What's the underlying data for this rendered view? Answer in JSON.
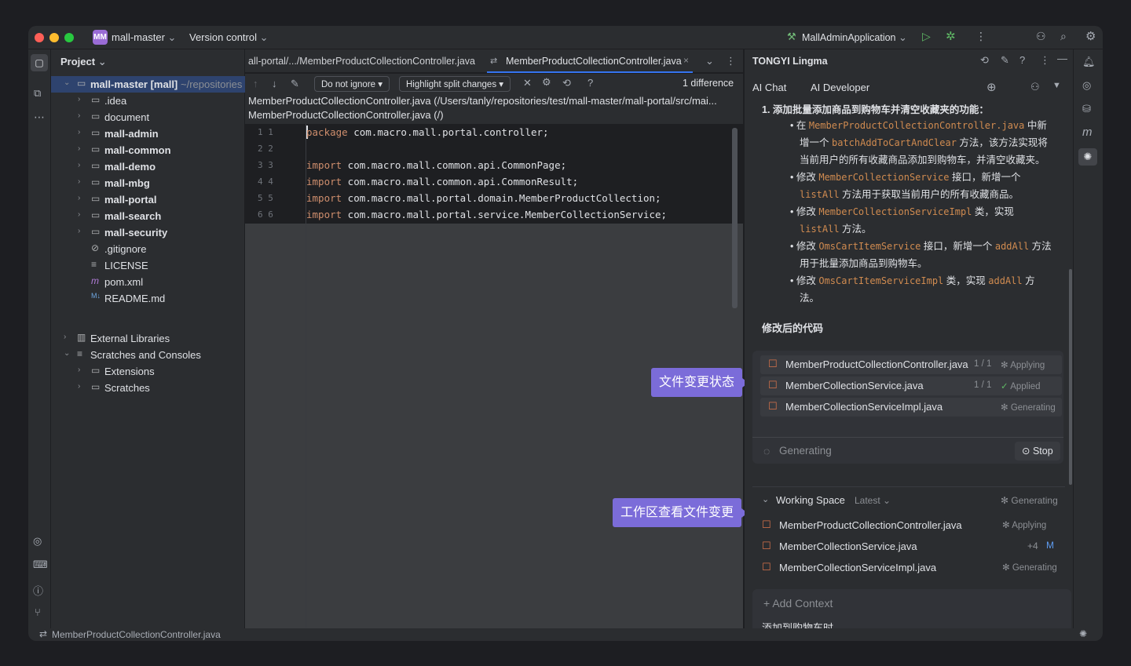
{
  "titlebar": {
    "project_badge": "MM",
    "project_name": "mall-master",
    "vcs": "Version control",
    "run_config": "MallAdminApplication"
  },
  "project_panel": {
    "title": "Project",
    "root": "mall-master [mall]",
    "root_path": "~/repositories",
    "items": [
      {
        "label": "idea",
        "display": ".idea",
        "icon": "folder-icon"
      },
      {
        "label": "document",
        "display": "document",
        "icon": "folder-icon"
      },
      {
        "label": "mall-admin",
        "display": "mall-admin",
        "icon": "module-folder-icon"
      },
      {
        "label": "mall-common",
        "display": "mall-common",
        "icon": "module-folder-icon"
      },
      {
        "label": "mall-demo",
        "display": "mall-demo",
        "icon": "module-folder-icon"
      },
      {
        "label": "mall-mbg",
        "display": "mall-mbg",
        "icon": "module-folder-icon"
      },
      {
        "label": "mall-portal",
        "display": "mall-portal",
        "icon": "module-folder-icon"
      },
      {
        "label": "mall-search",
        "display": "mall-search",
        "icon": "module-folder-icon"
      },
      {
        "label": "mall-security",
        "display": "mall-security",
        "icon": "module-folder-icon"
      },
      {
        "label": "gitignore",
        "display": ".gitignore",
        "icon": "ignore-file-icon"
      },
      {
        "label": "license",
        "display": "LICENSE",
        "icon": "text-file-icon"
      },
      {
        "label": "pom",
        "display": "pom.xml",
        "icon": "maven-icon"
      },
      {
        "label": "readme",
        "display": "README.md",
        "icon": "markdown-icon"
      }
    ],
    "external_libraries": "External Libraries",
    "scratches_and_consoles": "Scratches and Consoles",
    "extensions": "Extensions",
    "scratches": "Scratches"
  },
  "editor": {
    "tab1": "all-portal/.../MemberProductCollectionController.java",
    "tab2": "MemberProductCollectionController.java",
    "do_not_ignore": "Do not ignore",
    "highlight": "Highlight split changes",
    "difference": "1 difference",
    "path1": "MemberProductCollectionController.java (/Users/tanly/repositories/test/mall-master/mall-portal/src/mai...",
    "path2": "MemberProductCollectionController.java (/)"
  },
  "code_lines": [
    {
      "g": "1 1",
      "k": "package",
      "r": " com.macro.mall.portal.controller;"
    },
    {
      "g": "2 2",
      "k": "",
      "r": ""
    },
    {
      "g": "3 3",
      "k": "import",
      "r": " com.macro.mall.common.api.CommonPage;"
    },
    {
      "g": "4 4",
      "k": "import",
      "r": " com.macro.mall.common.api.CommonResult;"
    },
    {
      "g": "5 5",
      "k": "import",
      "r": " com.macro.mall.portal.domain.MemberProductCollection;"
    },
    {
      "g": "6 6",
      "k": "import",
      "r": " com.macro.mall.portal.service.MemberCollectionService;"
    }
  ],
  "right_panel": {
    "title": "TONGYI Lingma",
    "tab_chat": "AI Chat",
    "tab_dev": "AI Developer",
    "heading": "1. 添加批量添加商品到购物车并清空收藏夹的功能：",
    "b1_pre": "在 ",
    "b1_code1": "MemberProductCollectionController.java",
    "b1_mid": " 中新",
    "b1_l2_pre": "增一个 ",
    "b1_code2": "batchAddToCartAndClear",
    "b1_l2_post": " 方法，该方法实现将",
    "b1_l3": "当前用户的所有收藏商品添加到购物车，并清空收藏夹。",
    "b2_pre": "修改 ",
    "b2_code": "MemberCollectionService",
    "b2_post": " 接口，新增一个",
    "b2_code2": "listAll",
    "b2_l2_post": " 方法用于获取当前用户的所有收藏商品。",
    "b3_pre": "修改 ",
    "b3_code": "MemberCollectionServiceImpl",
    "b3_post": " 类，实现",
    "b3_code2": "listAll",
    "b3_l2_post": " 方法。",
    "b4_pre": "修改 ",
    "b4_code": "OmsCartItemService",
    "b4_post": " 接口，新增一个 ",
    "b4_code2": "addAll",
    "b4_post2": " 方法",
    "b4_l2": "用于批量添加商品到购物车。",
    "b5_pre": "修改 ",
    "b5_code": "OmsCartItemServiceImpl",
    "b5_post": " 类，实现 ",
    "b5_code2": "addAll",
    "b5_post2": " 方",
    "b5_l2": "法。",
    "modified_title": "修改后的代码",
    "files": [
      {
        "name": "MemberProductCollectionController.java",
        "count": "1 / 1",
        "status": "Applying"
      },
      {
        "name": "MemberCollectionService.java",
        "count": "1 / 1",
        "status": "Applied"
      },
      {
        "name": "MemberCollectionServiceImpl.java",
        "count": "",
        "status": "Generating"
      }
    ],
    "generating": "Generating",
    "stop": "Stop",
    "workspace_title": "Working Space",
    "workspace_latest": "Latest",
    "workspace_status": "Generating",
    "ws_files": [
      {
        "name": "MemberProductCollectionController.java",
        "status": "Applying"
      },
      {
        "name": "MemberCollectionService.java",
        "status": "+4",
        "flag": "M"
      },
      {
        "name": "MemberCollectionServiceImpl.java",
        "status": "Generating"
      }
    ],
    "add_context": "Add Context",
    "input_text": "添加到购物车时,"
  },
  "callouts": {
    "file_status": "文件变更状态",
    "workspace": "工作区查看文件变更"
  },
  "statusbar": {
    "file": "MemberProductCollectionController.java"
  },
  "colors": {
    "accent": "#7b6cd9",
    "bg": "#1e1f22",
    "panel": "#2b2d30",
    "code_hl": "#3b3d40"
  }
}
